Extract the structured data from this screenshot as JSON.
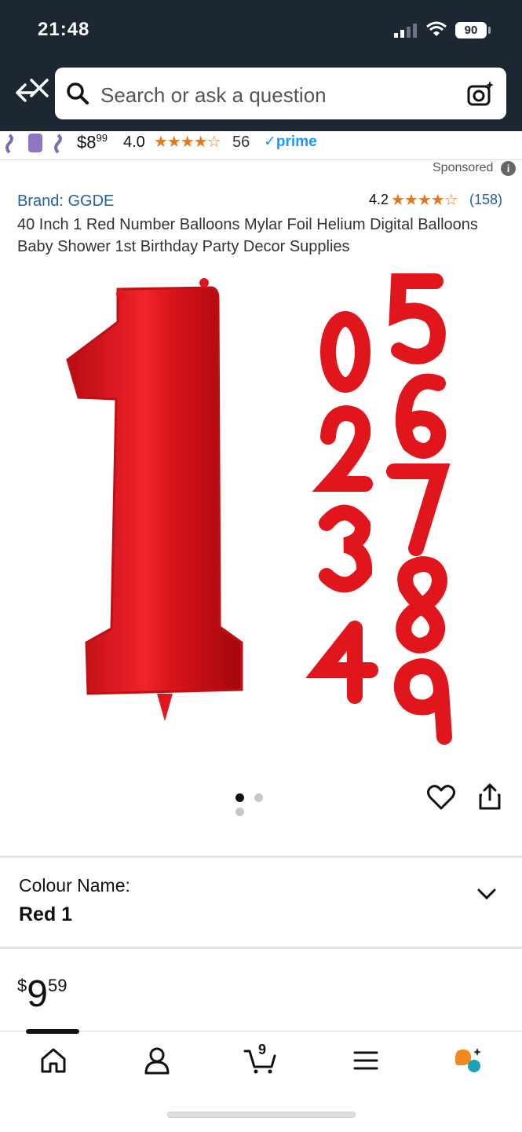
{
  "status_bar": {
    "time": "21:48",
    "battery": "90"
  },
  "search": {
    "placeholder": "Search or ask a question"
  },
  "prev_item": {
    "price_whole": "$8",
    "price_frac": "99",
    "rating": "4.0",
    "stars": "★★★★☆",
    "review_count": "56",
    "prime": "✓prime"
  },
  "sponsored": {
    "label": "Sponsored",
    "info": "i"
  },
  "product": {
    "brand": "Brand: GGDE",
    "rating": "4.2",
    "stars": "★★★★☆",
    "review_count": "(158)",
    "title": "40 Inch 1 Red Number Balloons Mylar Foil Helium Digital Balloons Baby Shower 1st Birthday Party Decor Supplies",
    "image_digits": [
      "1",
      "0",
      "2",
      "3",
      "4",
      "5",
      "6",
      "7",
      "8",
      "9"
    ],
    "image_count": 3,
    "active_image": 1
  },
  "variant": {
    "label": "Colour Name:",
    "value": "Red 1"
  },
  "price": {
    "symbol": "$",
    "whole": "9",
    "fraction": "59"
  },
  "bottom_nav": {
    "cart_count": "9",
    "items": [
      "home-icon",
      "account-icon",
      "cart-icon",
      "menu-icon",
      "rufus-icon"
    ]
  },
  "colors": {
    "header": "#1d2733",
    "link": "#2162a1",
    "star": "#de7921",
    "balloon": "#e0161c",
    "prime": "#1a98ff"
  }
}
